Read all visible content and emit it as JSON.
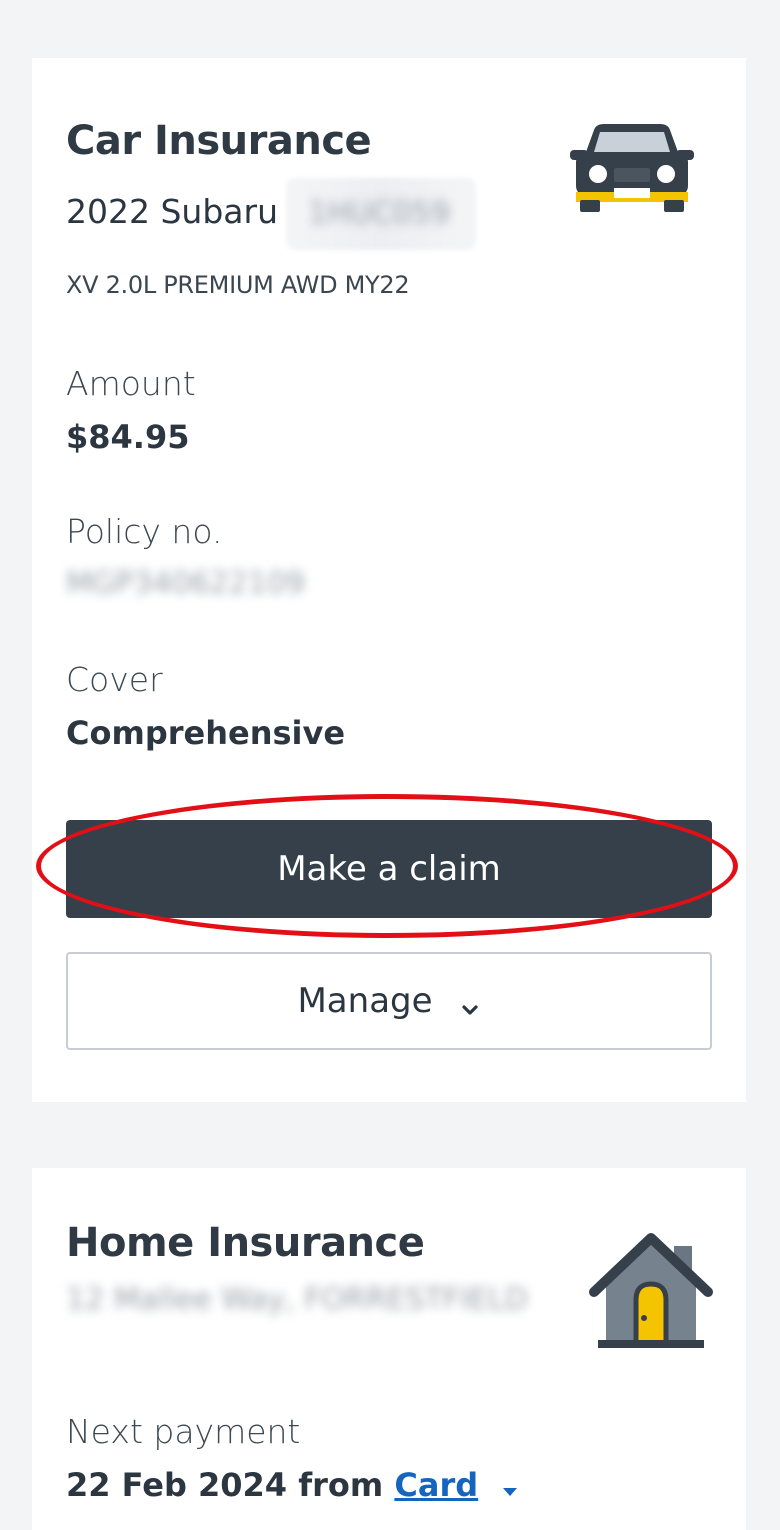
{
  "car": {
    "title": "Car Insurance",
    "vehicle": "2022 Subaru",
    "plate": "1HUC059",
    "model": "XV 2.0L PREMIUM AWD MY22",
    "amount_label": "Amount",
    "amount_value": "$84.95",
    "policy_label": "Policy no.",
    "policy_value": "MGP340622109",
    "cover_label": "Cover",
    "cover_value": "Comprehensive",
    "claim_button": "Make a claim",
    "manage_button": "Manage",
    "icon": "car-icon"
  },
  "home": {
    "title": "Home Insurance",
    "address": "12 Mallee Way, FORRESTFIELD",
    "next_payment_label": "Next payment",
    "next_payment_value": "22 Feb 2024 from",
    "payment_method": "Card",
    "icon": "house-icon"
  },
  "colors": {
    "accent_dark": "#36404a",
    "accent_yellow": "#f5c400",
    "link": "#1565c0",
    "annotation": "#e30f16"
  }
}
